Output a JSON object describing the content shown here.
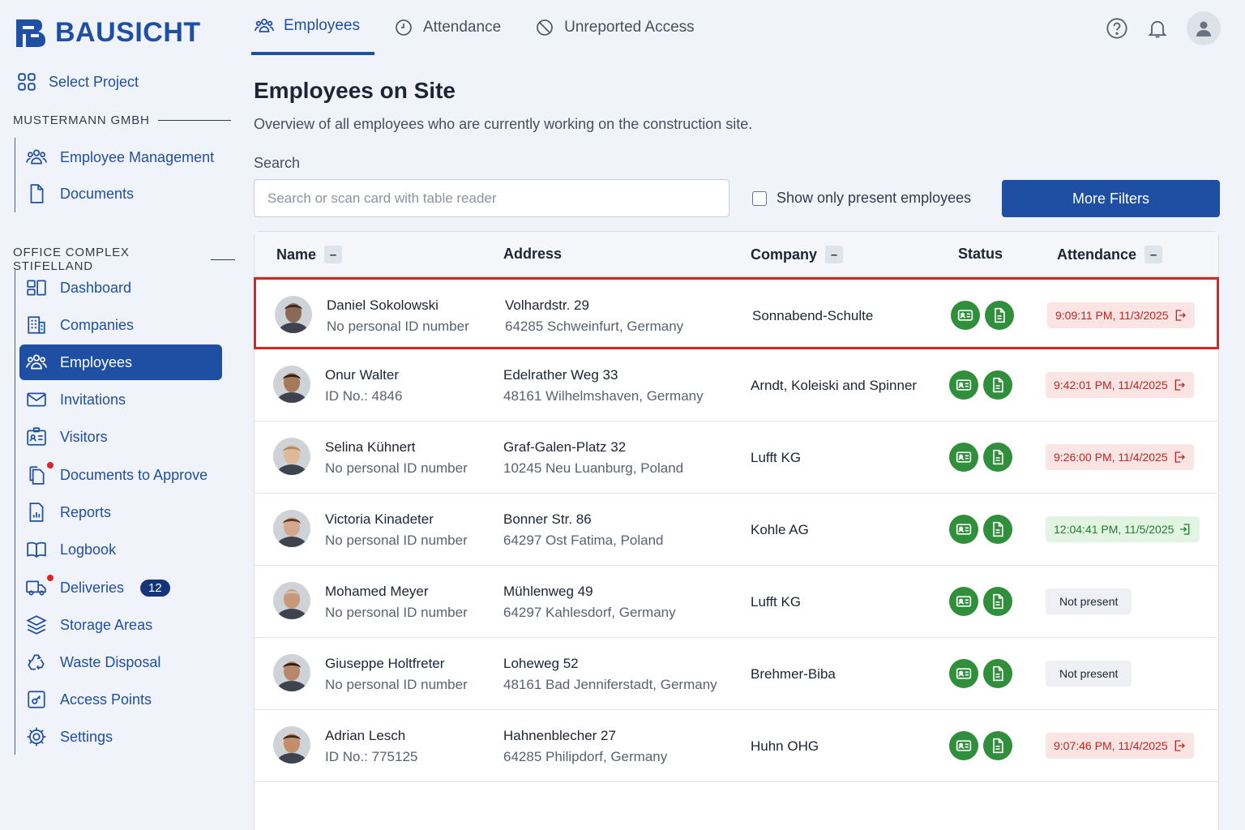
{
  "brand": {
    "name": "BAUSICHT"
  },
  "sidebar": {
    "select_project": "Select Project",
    "section_company": "MUSTERMANN GMBH",
    "company_items": [
      {
        "label": "Employee Management",
        "icon": "users-icon"
      },
      {
        "label": "Documents",
        "icon": "document-icon"
      }
    ],
    "section_project": "OFFICE COMPLEX STIFELLAND",
    "project_items": [
      {
        "label": "Dashboard",
        "icon": "dashboard-icon"
      },
      {
        "label": "Companies",
        "icon": "building-icon"
      },
      {
        "label": "Employees",
        "icon": "users-icon",
        "active": true
      },
      {
        "label": "Invitations",
        "icon": "mail-icon"
      },
      {
        "label": "Visitors",
        "icon": "visitor-badge-icon"
      },
      {
        "label": "Documents to Approve",
        "icon": "documents-icon",
        "alert": true
      },
      {
        "label": "Reports",
        "icon": "report-icon"
      },
      {
        "label": "Logbook",
        "icon": "book-icon"
      },
      {
        "label": "Deliveries",
        "icon": "truck-icon",
        "alert": true,
        "count": "12"
      },
      {
        "label": "Storage Areas",
        "icon": "layers-icon"
      },
      {
        "label": "Waste Disposal",
        "icon": "recycle-icon"
      },
      {
        "label": "Access Points",
        "icon": "access-point-icon"
      },
      {
        "label": "Settings",
        "icon": "gear-icon"
      }
    ]
  },
  "topnav": {
    "tabs": [
      {
        "label": "Employees",
        "icon": "users-icon",
        "active": true
      },
      {
        "label": "Attendance",
        "icon": "clock-icon"
      },
      {
        "label": "Unreported Access",
        "icon": "prohibited-icon"
      }
    ]
  },
  "main": {
    "title": "Employees on Site",
    "subtitle": "Overview of all employees who are currently working on the construction site.",
    "search_label": "Search",
    "search_placeholder": "Search or scan card with table reader",
    "search_value": "",
    "present_only_label": "Show only present employees",
    "present_only_checked": false,
    "more_filters": "More Filters"
  },
  "table": {
    "columns": {
      "name": "Name",
      "address": "Address",
      "company": "Company",
      "status": "Status",
      "attendance": "Attendance",
      "sort_symbol": "–"
    },
    "rows": [
      {
        "name": "Daniel Sokolowski",
        "id": "No personal ID number",
        "addr1": "Volhardstr. 29",
        "addr2": "64285 Schweinfurt, Germany",
        "company": "Sonnabend-Schulte",
        "attendance": "9:09:11 PM, 11/3/2025",
        "att_state": "out",
        "selected": true,
        "skin": "#8a6a55",
        "hair": "#3a2a20"
      },
      {
        "name": "Onur Walter",
        "id": "ID No.: 4846",
        "addr1": "Edelrather Weg 33",
        "addr2": "48161 Wilhelmshaven, Germany",
        "company": "Arndt, Koleiski and Spinner",
        "attendance": "9:42:01 PM, 11/4/2025",
        "att_state": "out",
        "skin": "#a5785a",
        "hair": "#2b1f18"
      },
      {
        "name": "Selina Kühnert",
        "id": "No personal ID number",
        "addr1": "Graf-Galen-Platz 32",
        "addr2": "10245 Neu Luanburg, Poland",
        "company": "Lufft KG",
        "attendance": "9:26:00 PM, 11/4/2025",
        "att_state": "out",
        "skin": "#e0b99a",
        "hair": "#b08a60"
      },
      {
        "name": "Victoria Kinadeter",
        "id": "No personal ID number",
        "addr1": "Bonner Str. 86",
        "addr2": "64297 Ost Fatima, Poland",
        "company": "Kohle AG",
        "attendance": "12:04:41 PM, 11/5/2025",
        "att_state": "in",
        "skin": "#d4a88a",
        "hair": "#5a3a28"
      },
      {
        "name": "Mohamed Meyer",
        "id": "No personal ID number",
        "addr1": "Mühlenweg 49",
        "addr2": "64297 Kahlesdorf, Germany",
        "company": "Lufft KG",
        "attendance": "Not present",
        "att_state": "none",
        "skin": "#c99878",
        "hair": "#c9c4be"
      },
      {
        "name": "Giuseppe Holtfreter",
        "id": "No personal ID number",
        "addr1": "Loheweg 52",
        "addr2": "48161 Bad Jenniferstadt, Germany",
        "company": "Brehmer-Biba",
        "attendance": "Not present",
        "att_state": "none",
        "skin": "#b8876a",
        "hair": "#2a1d15"
      },
      {
        "name": "Adrian Lesch",
        "id": "ID No.: 775125",
        "addr1": "Hahnenblecher 27",
        "addr2": "64285 Philipdorf, Germany",
        "company": "Huhn OHG",
        "attendance": "9:07:46 PM, 11/4/2025",
        "att_state": "out",
        "skin": "#c48e68",
        "hair": "#3d2a1c"
      }
    ]
  },
  "colors": {
    "primary": "#1f4fa3",
    "status_green": "#2f8f3b",
    "checkout_red": "#c0251e",
    "selection_border": "#d9261c"
  }
}
